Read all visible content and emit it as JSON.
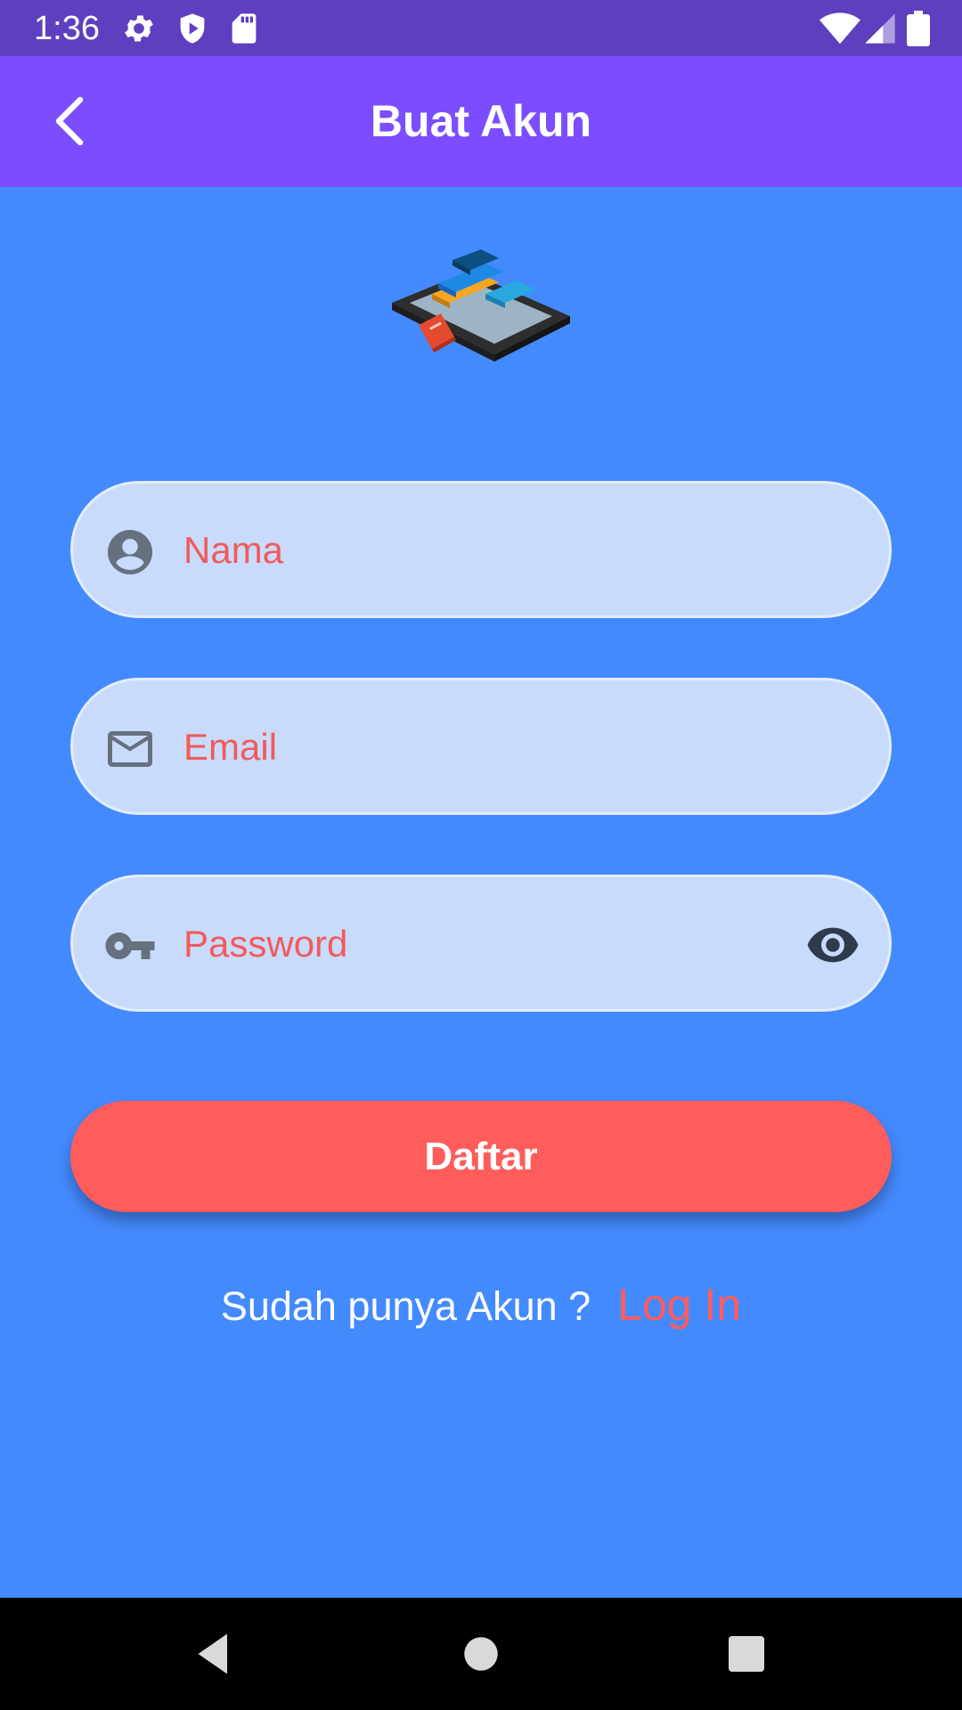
{
  "status_bar": {
    "time": "1:36",
    "icons": [
      "gear-icon",
      "shield-play-icon",
      "sd-card-icon",
      "wifi-icon",
      "cell-signal-icon",
      "battery-icon"
    ]
  },
  "app_bar": {
    "title": "Buat Akun",
    "back_icon": "chevron-left-icon"
  },
  "logo": {
    "name": "books-tablet-illustration"
  },
  "form": {
    "name_field": {
      "placeholder": "Nama",
      "value": "",
      "icon": "account-circle-icon"
    },
    "email_field": {
      "placeholder": "Email",
      "value": "",
      "icon": "mail-outline-icon"
    },
    "password_field": {
      "placeholder": "Password",
      "value": "",
      "icon": "key-icon",
      "toggle_icon": "eye-icon"
    },
    "submit_label": "Daftar"
  },
  "login": {
    "prompt": "Sudah punya Akun ?",
    "link": "Log In"
  },
  "nav_bar": {
    "icons": [
      "back-triangle-icon",
      "home-circle-icon",
      "recents-square-icon"
    ]
  },
  "colors": {
    "status_bar": "#5E3FC0",
    "app_bar": "#7C4DFF",
    "background": "#448AFF",
    "field_bg": "#C8DBFC",
    "accent_red": "#FF5C5C",
    "placeholder": "#F25A5A",
    "icon_gray": "#66707E"
  }
}
